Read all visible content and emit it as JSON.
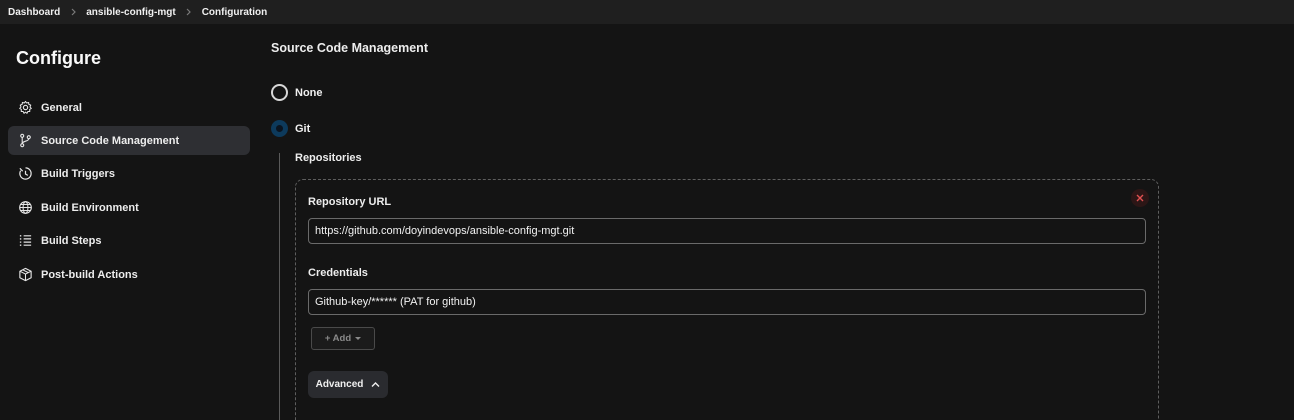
{
  "breadcrumb": {
    "items": [
      {
        "label": "Dashboard"
      },
      {
        "label": "ansible-config-mgt"
      },
      {
        "label": "Configuration"
      }
    ]
  },
  "sidebar": {
    "title": "Configure",
    "active_item": "Source Code Management",
    "items": [
      {
        "label": "General",
        "icon": "gear-icon"
      },
      {
        "label": "Source Code Management",
        "icon": "git-branch-icon"
      },
      {
        "label": "Build Triggers",
        "icon": "timer-icon"
      },
      {
        "label": "Build Environment",
        "icon": "globe-icon"
      },
      {
        "label": "Build Steps",
        "icon": "list-icon"
      },
      {
        "label": "Post-build Actions",
        "icon": "package-icon"
      }
    ]
  },
  "scm": {
    "title": "Source Code Management",
    "options": [
      {
        "label": "None",
        "selected": false
      },
      {
        "label": "Git",
        "selected": true
      }
    ],
    "repositories": {
      "heading": "Repositories",
      "url_label": "Repository URL",
      "url_value": "https://github.com/doyindevops/ansible-config-mgt.git",
      "credentials_label": "Credentials",
      "credentials_value": "Github-key/****** (PAT for github)",
      "add_button": "+ Add",
      "advanced_button": "Advanced"
    }
  },
  "colors": {
    "background": "#141414",
    "topbar": "#1f1f1f",
    "active_item": "#2e2f33",
    "radio_selected": "#0d3a5c",
    "remove_icon": "#e05050"
  }
}
